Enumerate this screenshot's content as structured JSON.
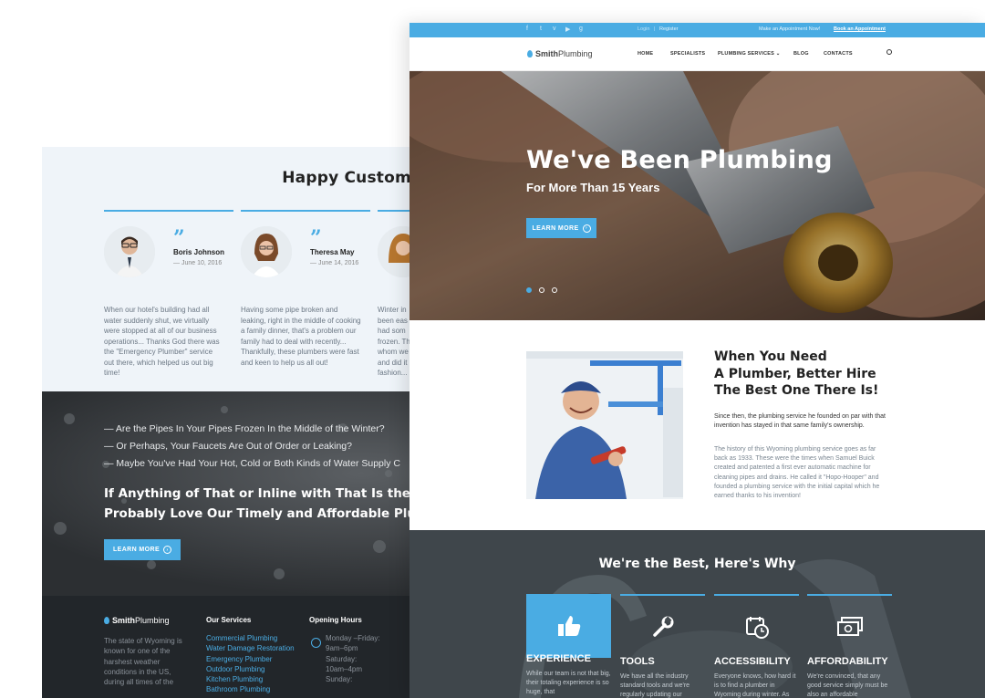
{
  "testimonials": {
    "title": "Happy Customers Speak Out",
    "items": [
      {
        "name": "Boris Johnson",
        "date": "June 10, 2016",
        "text": "When our hotel's building had all water suddenly shut, we virtually were stopped at all of our business operations... Thanks God there was the \"Emergency Plumber\" service out there, which helped us out big time!"
      },
      {
        "name": "Theresa May",
        "date": "June 14, 2016",
        "text": "Having some pipe broken and leaking, right in the middle of cooking a family dinner, that's a problem our family had to deal with recently... Thankfully, these plumbers were fast and keen to help us all out!"
      },
      {
        "name": "",
        "date": "",
        "text": "Winter in ... been eas... had some... frozen. Th... whom we... and did it... fashion..."
      }
    ],
    "third_lines": [
      "Winter in",
      "been eas",
      "had som",
      "frozen. Th",
      "whom we",
      "and did it",
      "fashion..."
    ]
  },
  "promo": {
    "questions": [
      "— Are the Pipes In Your Pipes Frozen In the Middle of the Winter?",
      "— Or Perhaps, Your Faucets Are Out of Order or Leaking?",
      "— Maybe You've Had Your Hot, Cold or Both Kinds of Water Supply C"
    ],
    "headline_1": "If Anything of That or Inline with That Is the Case,",
    "headline_2": "Probably Love Our Timely and Affordable Plumbin",
    "button": "LEARN MORE"
  },
  "footer": {
    "logo_bold": "Smith",
    "logo_light": "Plumbing",
    "about_lines": [
      "The state of Wyoming is",
      "known for one of the",
      "harshest weather",
      "conditions in the US,",
      "during all times of the"
    ],
    "services_title": "Our Services",
    "services": [
      "Commercial Plumbing",
      "Water Damage Restoration",
      "Emergency Plumber",
      "Outdoor Plumbing",
      "Kitchen Plumbing",
      "Bathroom Plumbing"
    ],
    "hours_title": "Opening Hours",
    "hours": [
      "Monday –Friday:",
      "9am–6pm",
      "Saturday:",
      "10am–4pm",
      "Sunday:"
    ]
  },
  "topbar": {
    "login": "Login",
    "register": "Register",
    "appointment_text": "Make an Appointment Now!",
    "appointment_link": "Book an Appointment"
  },
  "nav": {
    "logo_bold": "Smith",
    "logo_light": "Plumbing",
    "items": [
      "HOME",
      "SPECIALISTS",
      "PLUMBING SERVICES",
      "BLOG",
      "CONTACTS"
    ]
  },
  "hero": {
    "title": "We've Been Plumbing",
    "subtitle": "For More Than 15 Years",
    "button": "LEARN MORE",
    "slides": 3,
    "active_slide": 1
  },
  "about": {
    "heading_1": "When You Need",
    "heading_2": "A Plumber, Better Hire",
    "heading_3": "The Best One There Is!",
    "lead": "Since then, the plumbing service he founded on par with that invention has stayed in that same family's ownership.",
    "body": "The history of this Wyoming plumbing service goes as far back as 1933. These were the times when Samuel Buick created and patented a first ever automatic machine for cleaning pipes and drains. He called it \"Hopo-Hooper\" and founded a plumbing service with the initial capital which he earned thanks to his invention!"
  },
  "why": {
    "title": "We're the Best, Here's Why",
    "features": [
      {
        "name": "EXPERIENCE",
        "icon": "thumbs-up-icon",
        "text": "While our team is not that big, their totaling experience is so huge, that"
      },
      {
        "name": "TOOLS",
        "icon": "wrench-icon",
        "text": "We have all the industry standard tools and we're regularly updating our"
      },
      {
        "name": "ACCESSIBILITY",
        "icon": "calendar-clock-icon",
        "text": "Everyone knows, how hard it is to find a plumber in Wyoming during winter. As"
      },
      {
        "name": "AFFORDABILITY",
        "icon": "money-icon",
        "text": "We're convinced, that any good service simply must be also an affordable"
      }
    ]
  },
  "colors": {
    "accent": "#4aace3",
    "dark": "#22262a",
    "light_bg": "#eff4f9"
  }
}
